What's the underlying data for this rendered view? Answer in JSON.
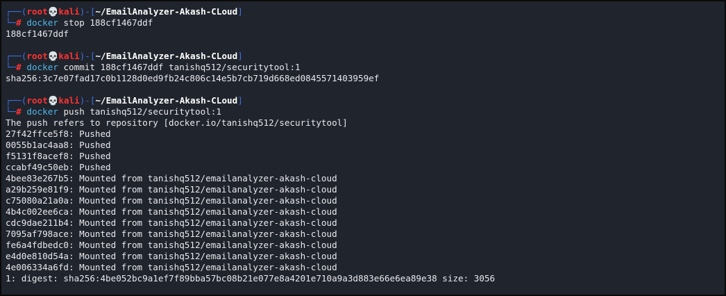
{
  "terminal": {
    "colors": {
      "background": "#20242c",
      "prompt_frame": "#3f6fe0",
      "user_host": "#ff3333",
      "command": "#4fb6e8",
      "text": "#e9e9ee"
    },
    "prompt": {
      "user": "root",
      "skull_glyph": "💀",
      "host": "kali",
      "path": "~/EmailAnalyzer-Akash-CLoud",
      "symbol": "#"
    },
    "blocks": [
      {
        "command": "docker",
        "args": " stop 188cf1467ddf",
        "output": [
          "188cf1467ddf"
        ]
      },
      {
        "command": "docker",
        "args": " commit 188cf1467ddf tanishq512/securitytool:1",
        "output": [
          "sha256:3c7e07fad17c0b1128d0ed9fb24c806c14e5b7cb719d668ed0845571403959ef"
        ]
      },
      {
        "command": "docker",
        "args": " push tanishq512/securitytool:1",
        "output": [
          "The push refers to repository [docker.io/tanishq512/securitytool]",
          "27f42ffce5f8: Pushed",
          "0055b1ac4aa8: Pushed",
          "f5131f8acef8: Pushed",
          "ccabf49c50eb: Pushed",
          "4bee83e267b5: Mounted from tanishq512/emailanalyzer-akash-cloud",
          "a29b259e81f9: Mounted from tanishq512/emailanalyzer-akash-cloud",
          "c75080a21a0a: Mounted from tanishq512/emailanalyzer-akash-cloud",
          "4b4c002ee6ca: Mounted from tanishq512/emailanalyzer-akash-cloud",
          "cdc9dae211b4: Mounted from tanishq512/emailanalyzer-akash-cloud",
          "7095af798ace: Mounted from tanishq512/emailanalyzer-akash-cloud",
          "fe6a4fdbedc0: Mounted from tanishq512/emailanalyzer-akash-cloud",
          "e4d0e810d54a: Mounted from tanishq512/emailanalyzer-akash-cloud",
          "4e006334a6fd: Mounted from tanishq512/emailanalyzer-akash-cloud",
          "1: digest: sha256:4be052bc9a1ef7f89bba57bc08b21e077e8a4201e710a9a3d883e66e6ea89e38 size: 3056"
        ]
      }
    ]
  }
}
